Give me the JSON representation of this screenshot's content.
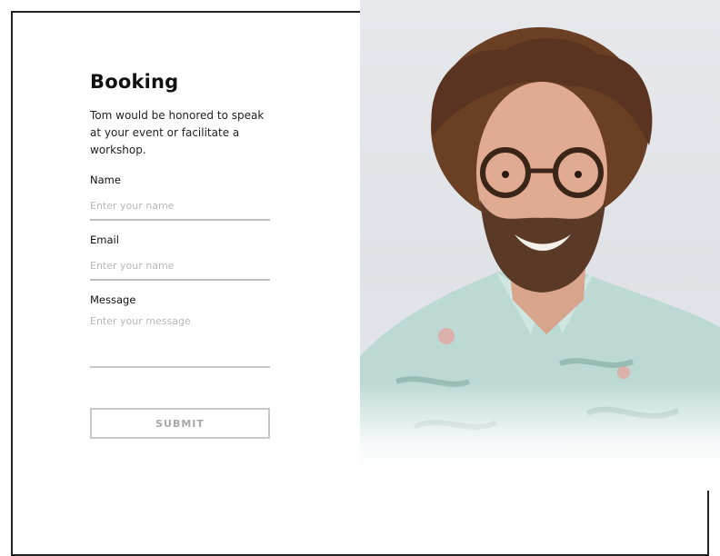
{
  "booking": {
    "title": "Booking",
    "description": "Tom would be honored to speak at your event or facilitate a workshop.",
    "fields": {
      "name": {
        "label": "Name",
        "placeholder": "Enter your name"
      },
      "email": {
        "label": "Email",
        "placeholder": "Enter your name"
      },
      "message": {
        "label": "Message",
        "placeholder": "Enter your message"
      }
    },
    "submit_label": "SUBMIT"
  },
  "photo": {
    "subject": "portrait-photo"
  },
  "colors": {
    "field_underline": "#bdbdbd",
    "button_border": "#c9c9c9",
    "placeholder": "#b8b8b8"
  }
}
